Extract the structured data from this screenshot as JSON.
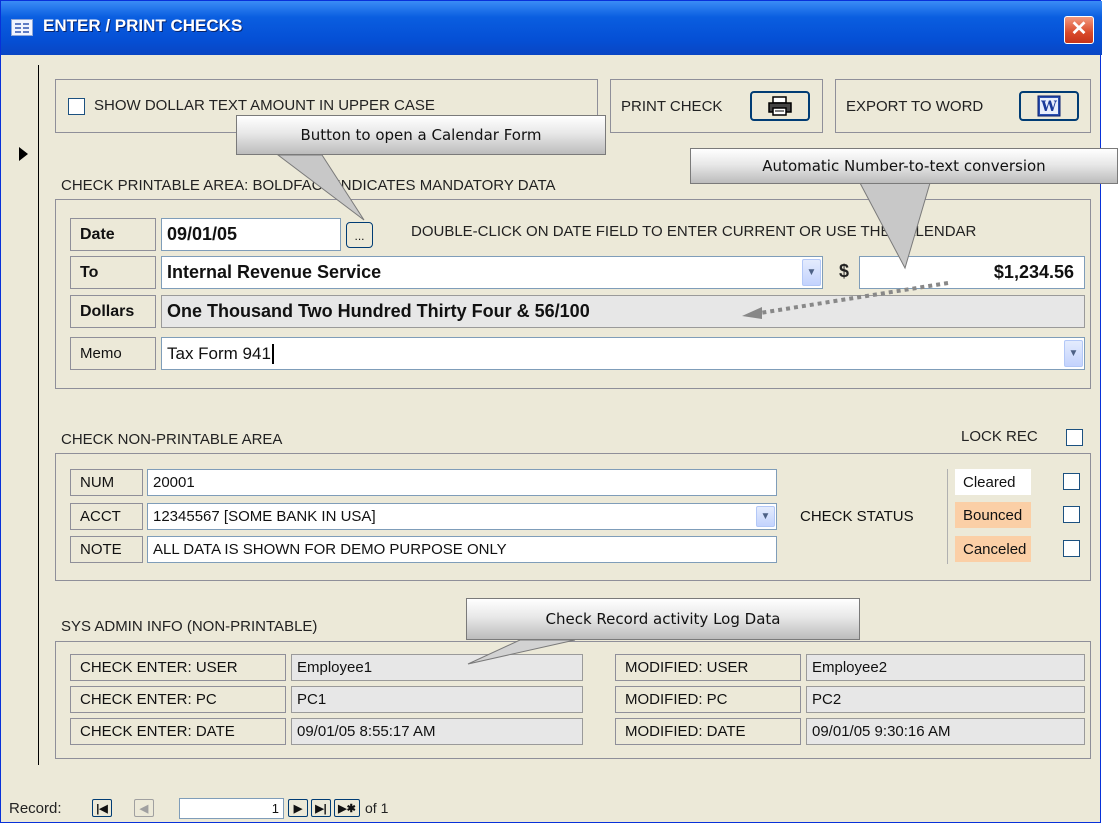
{
  "window": {
    "title": "ENTER / PRINT CHECKS",
    "close_glyph": "✕"
  },
  "toolbar": {
    "uppercase_checkbox_label": "SHOW DOLLAR TEXT AMOUNT IN UPPER CASE",
    "print_label": "PRINT CHECK",
    "export_label": "EXPORT TO WORD",
    "print_icon": "printer-icon",
    "export_icon": "word-icon"
  },
  "printable": {
    "section_label": "CHECK PRINTABLE AREA: BOLDFACE INDICATES MANDATORY DATA",
    "date_label": "Date",
    "date_value": "09/01/05",
    "calendar_button": "...",
    "date_hint": "DOUBLE-CLICK ON DATE FIELD TO ENTER CURRENT OR USE THE CALENDAR",
    "to_label": "To",
    "to_value": "Internal Revenue Service",
    "currency_symbol": "$",
    "amount_value": "$1,234.56",
    "dollars_label": "Dollars",
    "dollars_value": "One Thousand Two Hundred Thirty Four & 56/100",
    "memo_label": "Memo",
    "memo_value": "Tax Form 941"
  },
  "nonprintable": {
    "section_label": "CHECK NON-PRINTABLE AREA",
    "lock_label": "LOCK REC",
    "num_label": "NUM",
    "num_value": "20001",
    "acct_label": "ACCT",
    "acct_value": "12345567  [SOME BANK IN USA]",
    "note_label": "NOTE",
    "note_value": "ALL DATA IS SHOWN FOR DEMO PURPOSE ONLY",
    "status_label": "CHECK STATUS",
    "statuses": [
      {
        "label": "Cleared",
        "color": "#ffffff"
      },
      {
        "label": "Bounced",
        "color": "#fbcfa6"
      },
      {
        "label": "Canceled",
        "color": "#fbcfa6"
      }
    ]
  },
  "sysadmin": {
    "section_label": "SYS ADMIN INFO (NON-PRINTABLE)",
    "enter_user_label": "CHECK ENTER: USER",
    "enter_user_value": "Employee1",
    "enter_pc_label": "CHECK ENTER: PC",
    "enter_pc_value": "PC1",
    "enter_date_label": "CHECK ENTER: DATE",
    "enter_date_value": "09/01/05 8:55:17 AM",
    "mod_user_label": "MODIFIED: USER",
    "mod_user_value": "Employee2",
    "mod_pc_label": "MODIFIED: PC",
    "mod_pc_value": "PC2",
    "mod_date_label": "MODIFIED: DATE",
    "mod_date_value": "09/01/05 9:30:16 AM"
  },
  "callouts": {
    "calendar": "Button to open a Calendar Form",
    "conversion": "Automatic Number-to-text conversion",
    "log": "Check Record activity Log Data"
  },
  "navigation": {
    "record_label": "Record:",
    "current": "1",
    "of_label": "of 1"
  }
}
